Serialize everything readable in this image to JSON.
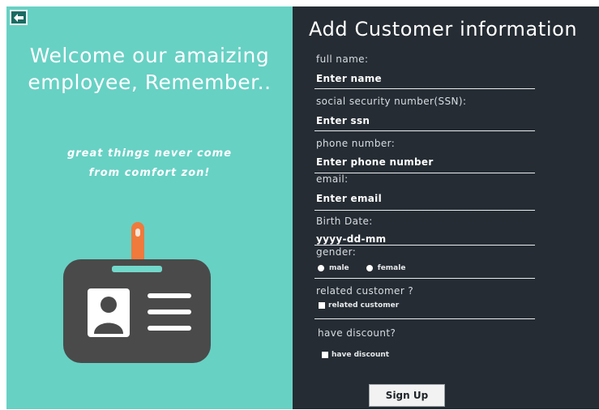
{
  "welcome": {
    "heading_line1": "Welcome our amaizing",
    "heading_line2": "employee, Remember..",
    "motto_line1": "great things never come",
    "motto_line2": "from comfort zon!"
  },
  "icons": {
    "back": "back-arrow-icon",
    "badge": "id-badge-icon"
  },
  "form": {
    "title": "Add Customer information",
    "full_name": {
      "label": "full name:",
      "value": "Enter  name"
    },
    "ssn": {
      "label": "social security number(SSN):",
      "value": "Enter  ssn"
    },
    "phone": {
      "label": "phone number:",
      "value": "Enter  phone number"
    },
    "email": {
      "label": "email:",
      "value": "Enter  email"
    },
    "birth_date": {
      "label": "Birth Date:",
      "value": "yyyy-dd-mm"
    },
    "gender": {
      "label": "gender:",
      "options": [
        "male",
        "female"
      ]
    },
    "related": {
      "label": "related customer ?",
      "checkbox": "related customer"
    },
    "discount": {
      "label": "have discount?",
      "checkbox": "have discount"
    },
    "submit_label": "Sign Up"
  },
  "colors": {
    "left_panel": "#67d1c4",
    "right_panel": "#252c33",
    "badge_body": "#4a4a4a",
    "badge_strap": "#ef7a3c"
  }
}
